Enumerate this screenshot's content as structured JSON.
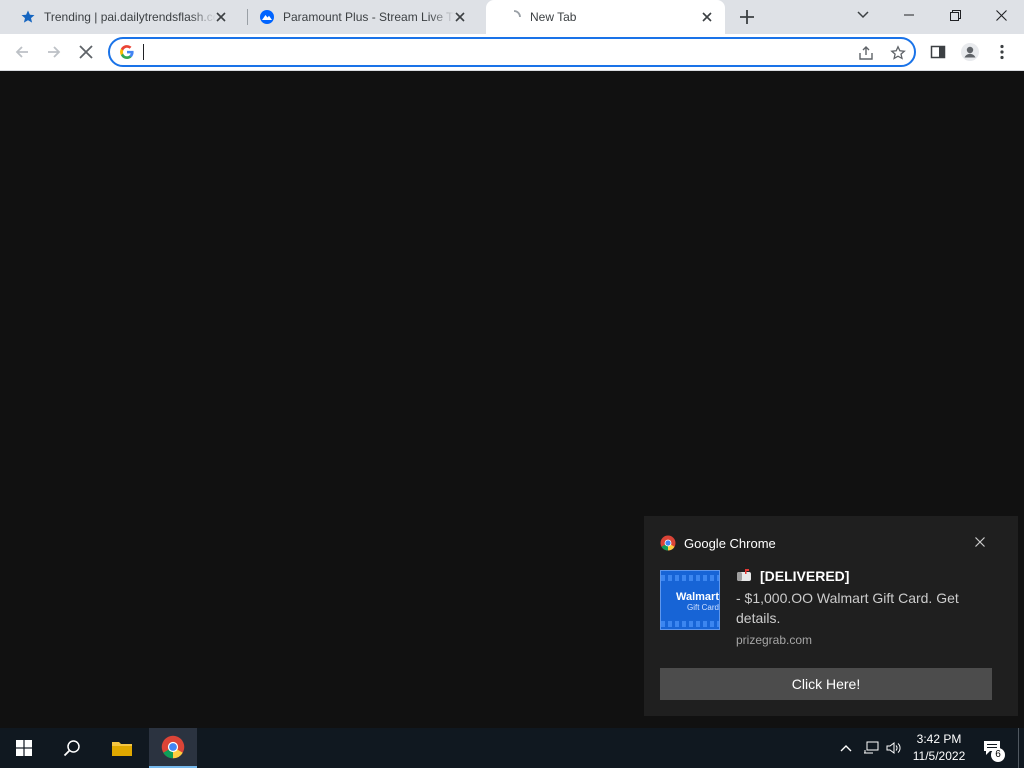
{
  "browser": {
    "tabs": [
      {
        "title": "Trending | pai.dailytrendsflash.com",
        "favicon": "star-favicon-icon",
        "active": false
      },
      {
        "title": "Paramount Plus - Stream Live TV",
        "favicon": "paramount-favicon-icon",
        "active": false
      },
      {
        "title": "New Tab",
        "favicon": "loading-spinner-icon",
        "active": true
      }
    ],
    "omnibox": {
      "value": "",
      "placeholder": ""
    },
    "accent": "#1a73e8"
  },
  "notification": {
    "app_name": "Google Chrome",
    "image_brand": "Walmart",
    "image_sub": "Gift Card",
    "title": "[DELIVERED]",
    "body": "- $1,000.OO Walmart Gift Card. Get details.",
    "source": "prizegrab.com",
    "button": "Click Here!"
  },
  "taskbar": {
    "time": "3:42 PM",
    "date": "11/5/2022",
    "notification_count": "6"
  }
}
